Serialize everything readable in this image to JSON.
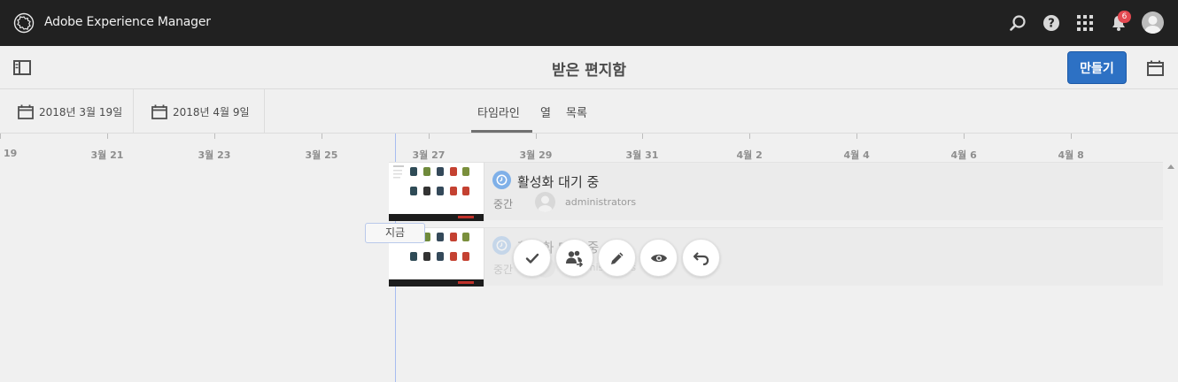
{
  "shell": {
    "app_title": "Adobe Experience Manager",
    "notification_count": "6",
    "icons": [
      "search-icon",
      "help-icon",
      "apps-grid-icon",
      "bell-icon",
      "user-avatar"
    ]
  },
  "actionbar": {
    "title": "받은 편지함",
    "create_label": "만들기"
  },
  "filters": {
    "start_date": "2018년 3월 19일",
    "end_date": "2018년 4월 9일",
    "views": [
      "타임라인",
      "열",
      "목록"
    ],
    "active_view": "타임라인"
  },
  "timeline": {
    "ticks": [
      "19",
      "3월 21",
      "3월 23",
      "3월 25",
      "3월 27",
      "3월 29",
      "3월 31",
      "4월 2",
      "4월 4",
      "4월 6",
      "4월 8"
    ],
    "now_label": "지금"
  },
  "items": [
    {
      "title": "활성화 대기 중",
      "priority": "중간",
      "assignee": "administrators"
    },
    {
      "title": "활성화 대기 중",
      "priority": "중간",
      "assignee": "administrators"
    }
  ],
  "quick_actions": [
    "check-icon",
    "assign-users-icon",
    "edit-pencil-icon",
    "eye-icon",
    "undo-icon"
  ],
  "colors": {
    "shell_bg": "#212121",
    "accent": "#2d71c4",
    "badge": "#e34850",
    "now_line": "#a7bcf0"
  }
}
